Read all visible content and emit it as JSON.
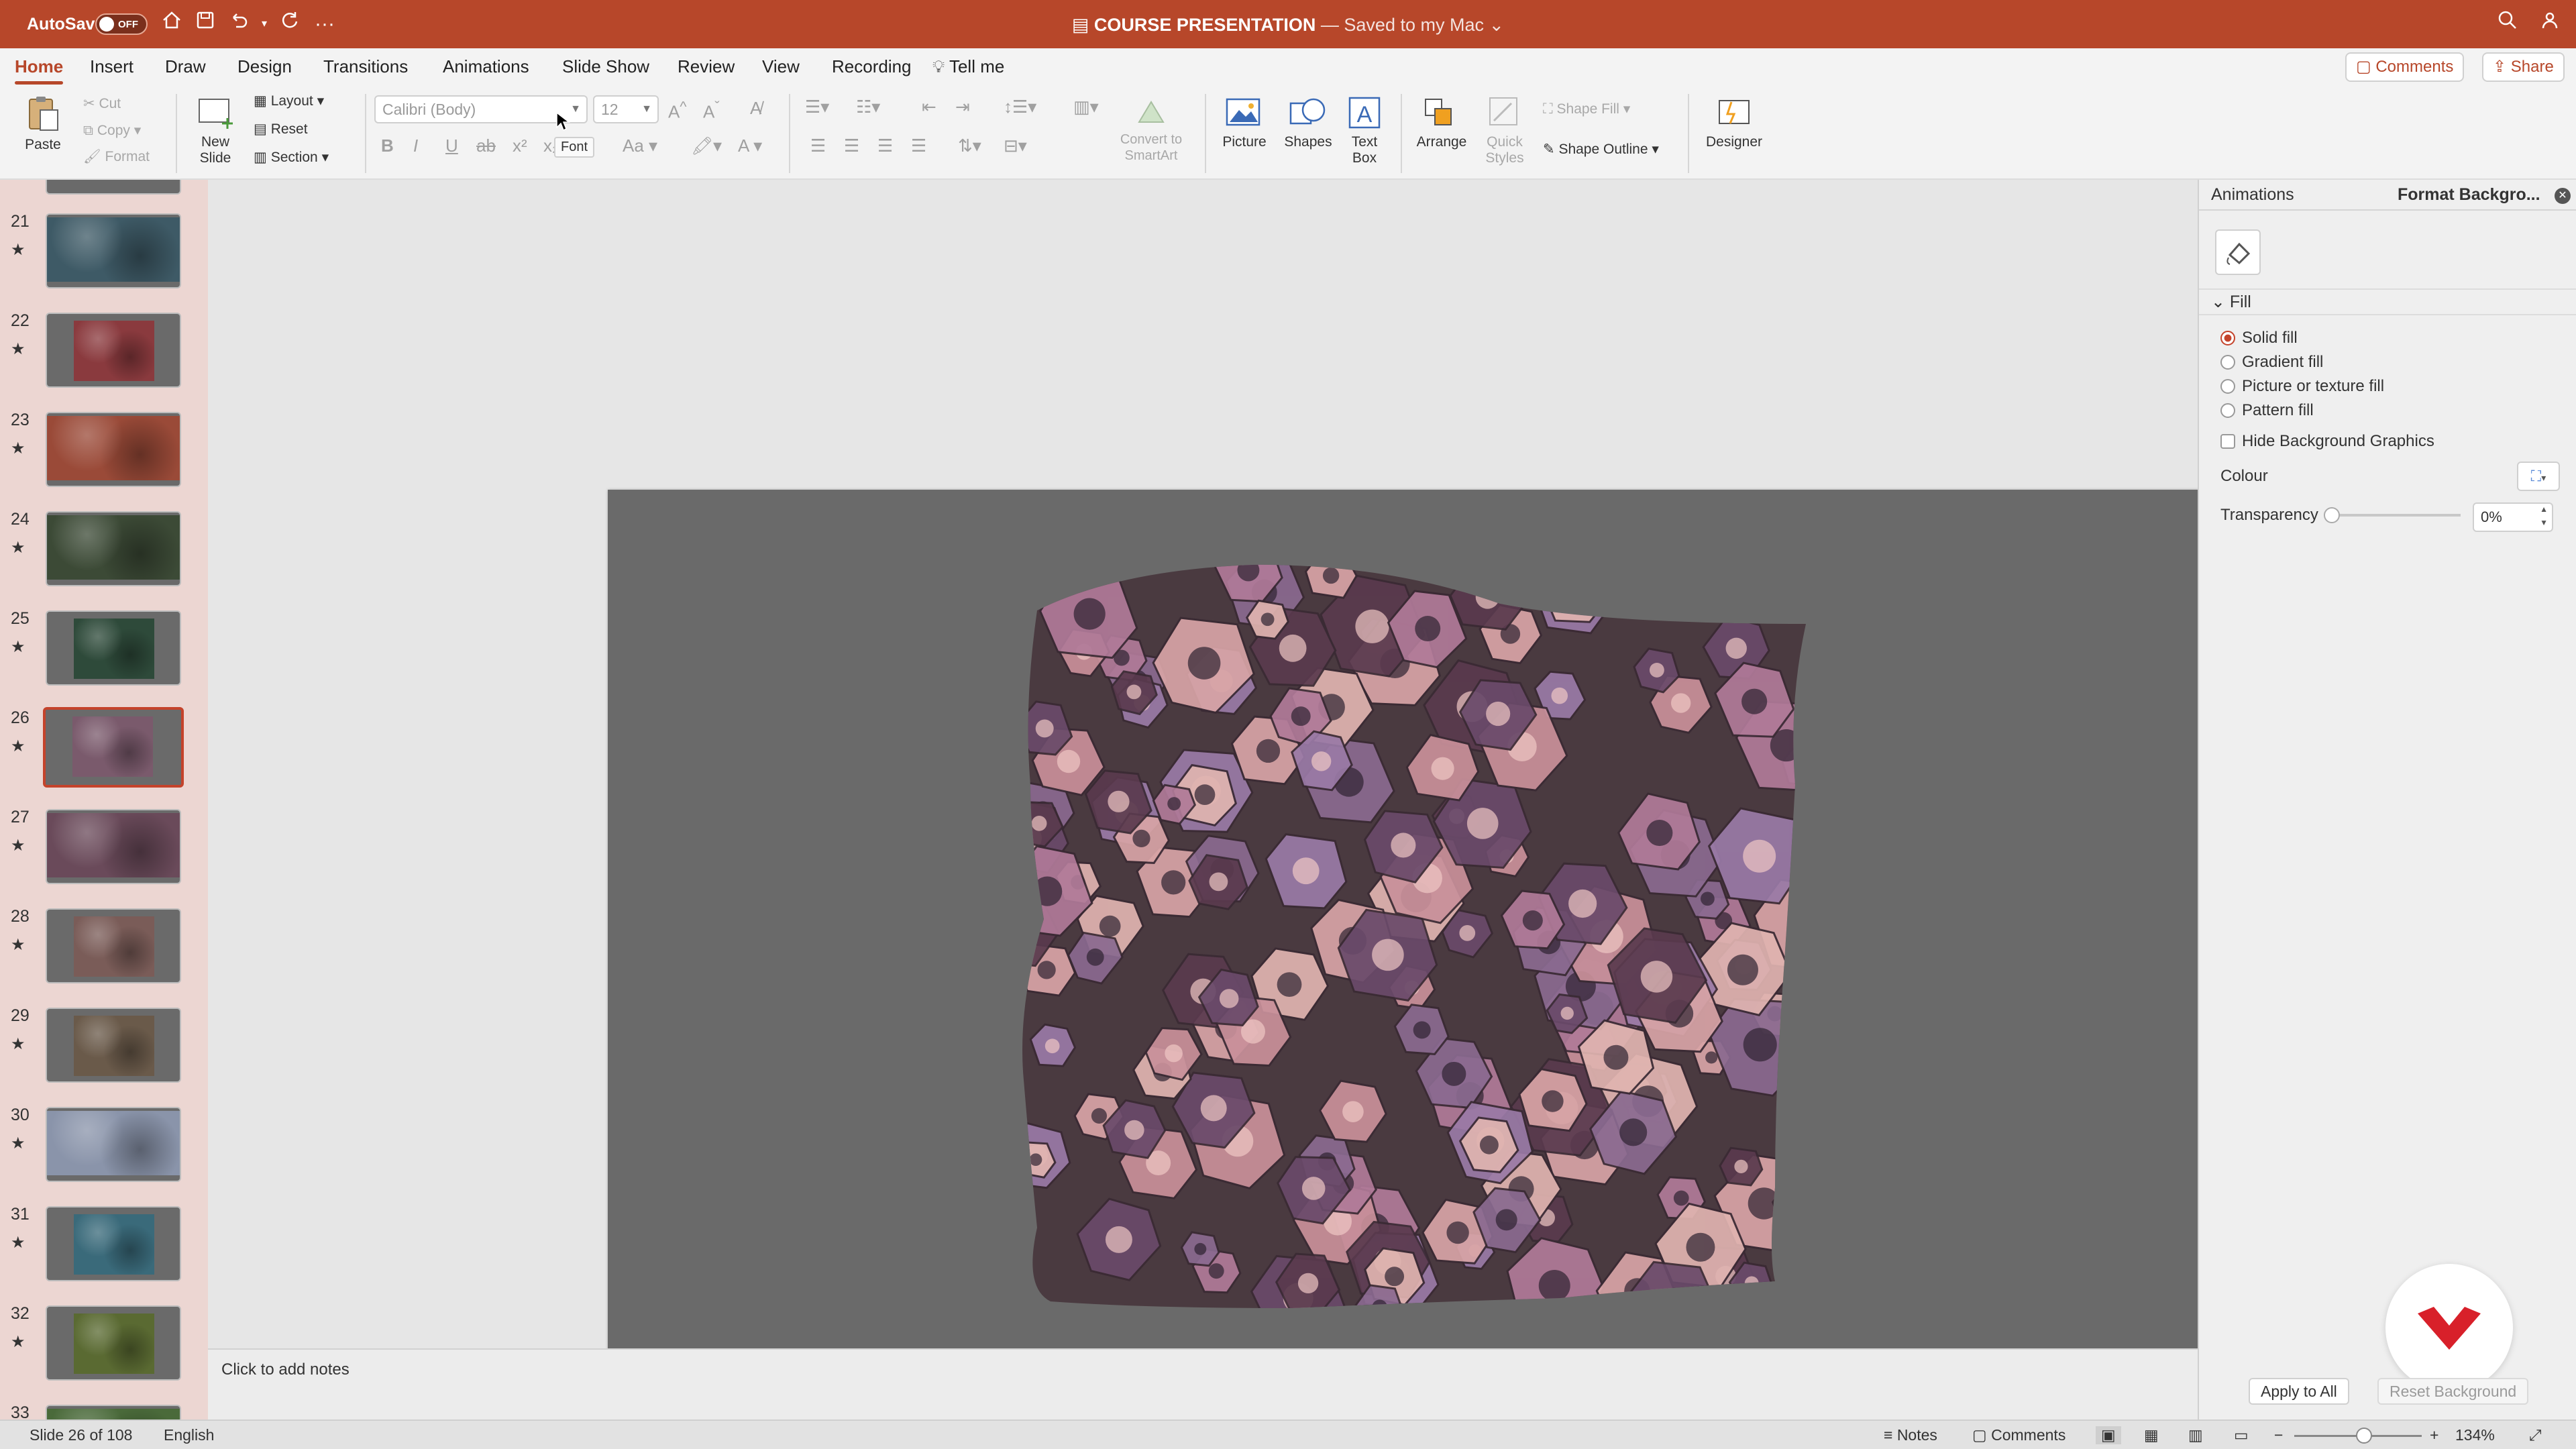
{
  "title_bar": {
    "autosave_label": "AutoSave",
    "autosave_state": "OFF",
    "doc_title": "COURSE PRESENTATION",
    "save_status": " — Saved to my Mac",
    "icons": [
      "home-icon",
      "save-icon",
      "undo-icon",
      "redo-icon",
      "more-icon",
      "search-icon",
      "share-people-icon"
    ]
  },
  "ribbon_tabs": [
    "Home",
    "Insert",
    "Draw",
    "Design",
    "Transitions",
    "Animations",
    "Slide Show",
    "Review",
    "View",
    "Recording"
  ],
  "tell_me": "Tell me",
  "top_buttons": {
    "comments": "Comments",
    "share": "Share"
  },
  "ribbon": {
    "paste": "Paste",
    "cut": "Cut",
    "copy": "Copy",
    "format": "Format",
    "new_slide": "New\nSlide",
    "layout": "Layout",
    "reset": "Reset",
    "section": "Section",
    "font_name": "Calibri (Body)",
    "font_size": "12",
    "font_tooltip": "Font",
    "convert_smartart": "Convert to\nSmartArt",
    "picture": "Picture",
    "shapes": "Shapes",
    "text_box": "Text\nBox",
    "arrange": "Arrange",
    "quick_styles": "Quick\nStyles",
    "shape_fill": "Shape Fill",
    "shape_outline": "Shape Outline",
    "designer": "Designer"
  },
  "slides": [
    {
      "num": "21",
      "tone": "#3e5a66"
    },
    {
      "num": "22",
      "tone": "#8a3a3e"
    },
    {
      "num": "23",
      "tone": "#9a4a38"
    },
    {
      "num": "24",
      "tone": "#3c4a36"
    },
    {
      "num": "25",
      "tone": "#2e4a3a"
    },
    {
      "num": "26",
      "tone": "#7a5a6c",
      "selected": true
    },
    {
      "num": "27",
      "tone": "#6a4a5a"
    },
    {
      "num": "28",
      "tone": "#7a5c58"
    },
    {
      "num": "29",
      "tone": "#6a5a4a"
    },
    {
      "num": "30",
      "tone": "#8a94aa"
    },
    {
      "num": "31",
      "tone": "#3a6a7a"
    },
    {
      "num": "32",
      "tone": "#5a6a32"
    },
    {
      "num": "33",
      "tone": "#4a6a3a"
    }
  ],
  "notes_placeholder": "Click to add notes",
  "format_pane": {
    "tabs": [
      "Animations",
      "Format Backgro..."
    ],
    "section": "Fill",
    "options": [
      "Solid fill",
      "Gradient fill",
      "Picture or texture fill",
      "Pattern fill"
    ],
    "selected_option": "Solid fill",
    "hide_bg_graphics": "Hide Background Graphics",
    "colour_label": "Colour",
    "transparency_label": "Transparency",
    "transparency_value": "0%",
    "apply_all": "Apply to All",
    "reset_bg": "Reset Background"
  },
  "status_bar": {
    "slide_info": "Slide 26 of 108",
    "language": "English",
    "notes": "Notes",
    "comments": "Comments",
    "zoom": "134%"
  },
  "colors": {
    "accent": "#b7472a",
    "slide_bg": "#6a6a6a",
    "panel_bg": "#ecd6d2"
  }
}
